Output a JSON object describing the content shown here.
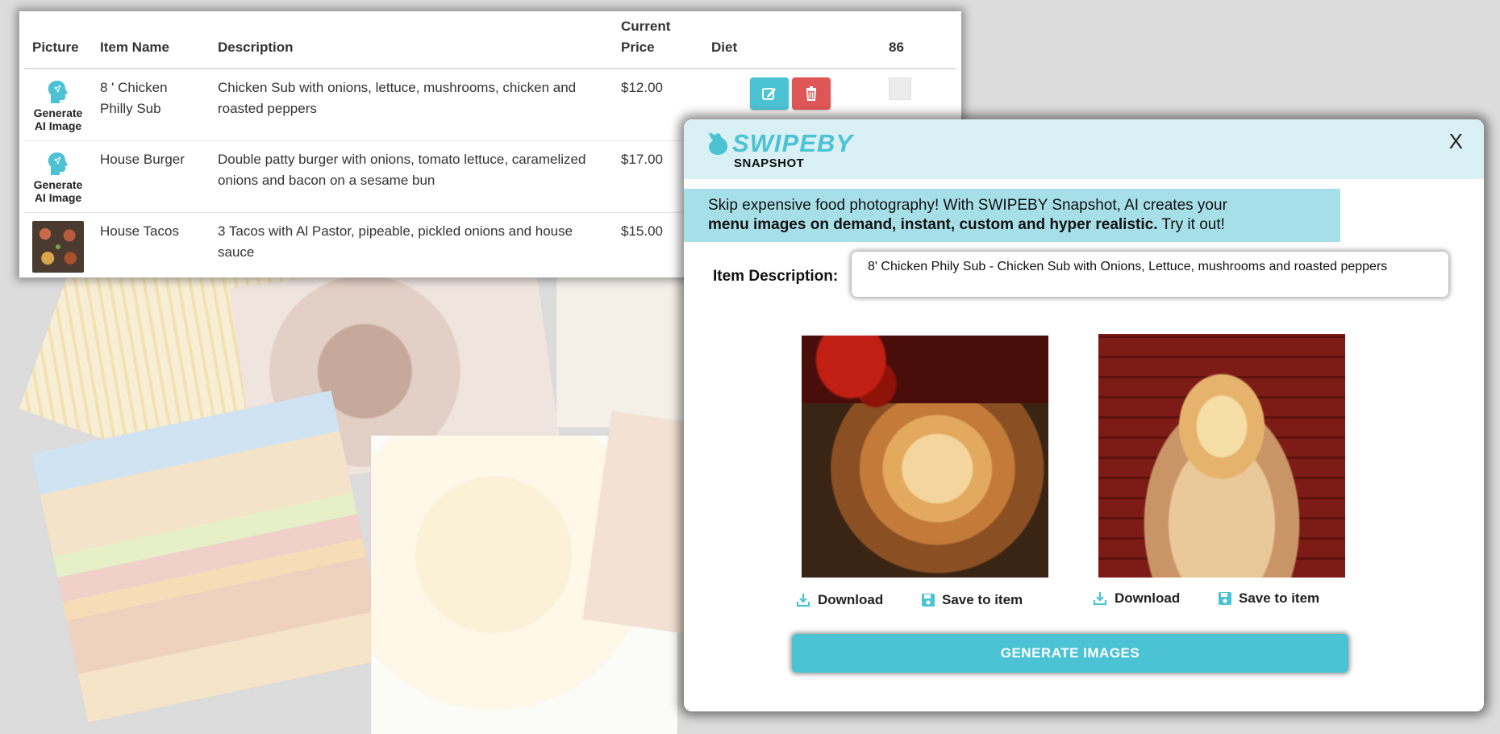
{
  "table": {
    "headers": {
      "picture": "Picture",
      "item_name": "Item Name",
      "description": "Description",
      "current_price_line1": "Current",
      "current_price_line2": "Price",
      "diet": "Diet",
      "col_86": "86"
    },
    "generate_ai_label_line1": "Generate",
    "generate_ai_label_line2": "AI Image",
    "rows": [
      {
        "name_line1": "8 ' Chicken",
        "name_line2": "Philly Sub",
        "description": "Chicken Sub with onions, lettuce, mushrooms, chicken and roasted peppers",
        "price": "$12.00"
      },
      {
        "name_line1": "House Burger",
        "name_line2": "",
        "description": "Double patty burger with onions, tomato lettuce, caramelized onions and bacon on a sesame bun",
        "price": "$17.00"
      },
      {
        "name_line1": "House Tacos",
        "name_line2": "",
        "description": "3 Tacos with Al Pastor, pipeable, pickled onions and house sauce",
        "price": "$15.00"
      }
    ]
  },
  "modal": {
    "brand": "SWIPEBY",
    "brand_sub": "SNAPSHOT",
    "close_label": "X",
    "banner_line1": "Skip expensive food photography! With SWIPEBY Snapshot, AI creates your",
    "banner_bold": "menu images on demand, instant, custom and hyper realistic.",
    "banner_tail": " Try it out!",
    "description_label": "Item Description:",
    "description_value": "8' Chicken Phily Sub - Chicken Sub with Onions, Lettuce, mushrooms and roasted peppers",
    "images": [
      {
        "download_label": "Download",
        "save_label": "Save to item"
      },
      {
        "download_label": "Download",
        "save_label": "Save to item"
      }
    ],
    "generate_label": "GENERATE IMAGES"
  },
  "colors": {
    "accent": "#4cc3d4",
    "danger": "#df5657",
    "header_bg": "#d9f0f5",
    "banner_bg": "#a7dfe8"
  },
  "icons": [
    "ai-head-icon",
    "edit-icon",
    "trash-icon",
    "download-icon",
    "save-icon",
    "swipeby-logo-icon"
  ]
}
